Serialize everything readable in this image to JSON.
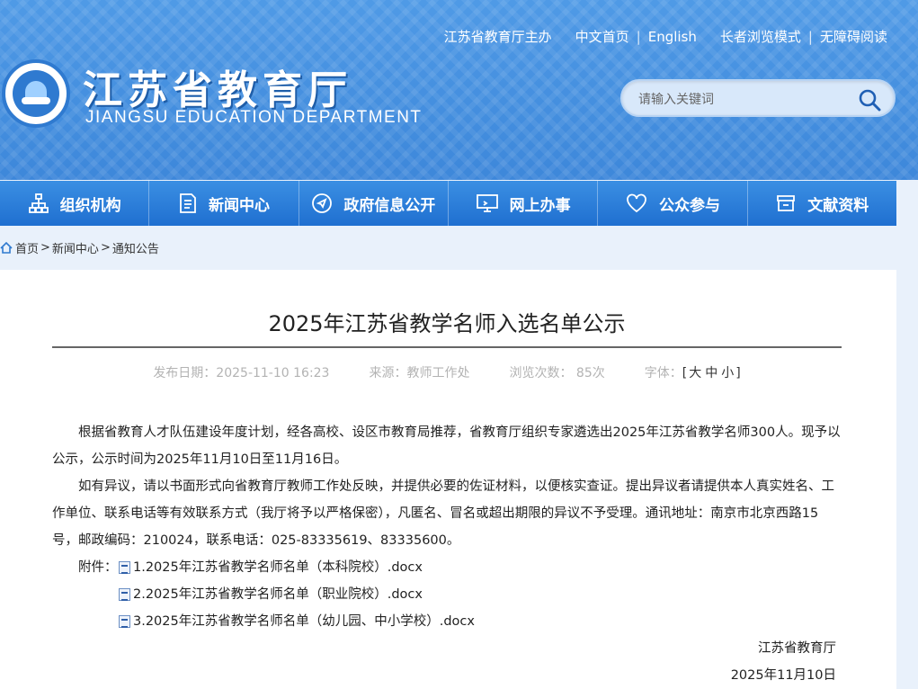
{
  "top_links": {
    "sponsor": "江苏省教育厅主办",
    "home": "中文首页",
    "english": "English",
    "elder_mode": "长者浏览模式",
    "accessible": "无障碍阅读"
  },
  "site": {
    "title": "江苏省教育厅",
    "subtitle": "JIANGSU EDUCATION DEPARTMENT"
  },
  "search": {
    "placeholder": "请输入关键词"
  },
  "nav": [
    {
      "label": "组织机构",
      "icon": "org-chart-icon"
    },
    {
      "label": "新闻中心",
      "icon": "document-icon"
    },
    {
      "label": "政府信息公开",
      "icon": "send-icon"
    },
    {
      "label": "网上办事",
      "icon": "monitor-icon"
    },
    {
      "label": "公众参与",
      "icon": "heart-icon"
    },
    {
      "label": "文献资料",
      "icon": "archive-icon"
    }
  ],
  "breadcrumb": {
    "home": "首页",
    "news": "新闻中心",
    "notice": "通知公告",
    "separator": ">"
  },
  "article": {
    "title": "2025年江苏省教学名师入选名单公示",
    "meta": {
      "date": "发布日期：2025-11-10 16:23",
      "source": "来源：教师工作处",
      "views": "浏览次数：  85次",
      "font_label": "字体：",
      "font_large": "大",
      "font_medium": "中",
      "font_small": "小"
    },
    "paragraph1": "根据省教育人才队伍建设年度计划，经各高校、设区市教育局推荐，省教育厅组织专家遴选出2025年江苏省教学名师300人。现予以公示，公示时间为2025年11月10日至11月16日。",
    "paragraph2": "如有异议，请以书面形式向省教育厅教师工作处反映，并提供必要的佐证材料，以便核实查证。提出异议者请提供本人真实姓名、工作单位、联系电话等有效联系方式（我厅将予以严格保密），凡匿名、冒名或超出期限的异议不予受理。通讯地址：南京市北京西路15号，邮政编码：210024，联系电话：025-83335619、83335600。",
    "attachments_label": "附件：",
    "attachments": [
      "1.2025年江苏省教学名师名单（本科院校）.docx",
      "2.2025年江苏省教学名师名单（职业院校）.docx",
      "3.2025年江苏省教学名师名单（幼儿园、中小学校）.docx"
    ],
    "signature": "江苏省教育厅",
    "sign_date": "2025年11月10日"
  },
  "colors": {
    "header_blue": "#3f8ee0",
    "nav_blue": "#1f6fd0",
    "page_bg": "#e9f1fb"
  }
}
